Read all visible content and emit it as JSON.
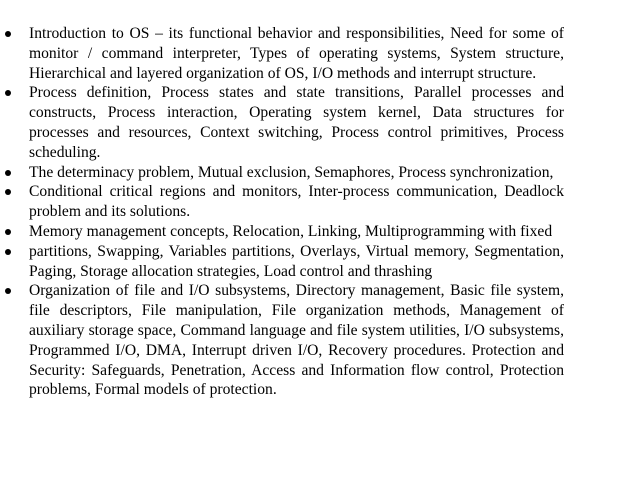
{
  "syllabus": {
    "items": [
      {
        "text": "Introduction to OS – its functional behavior and responsibilities, Need for some of monitor / command interpreter, Types of operating systems, System structure, Hierarchical and layered organization of OS, I/O methods and interrupt structure."
      },
      {
        "text": "Process definition, Process states and state transitions, Parallel processes and constructs, Process interaction, Operating system kernel, Data structures for processes and resources, Context switching, Process control primitives, Process scheduling."
      },
      {
        "text": "The determinacy problem, Mutual exclusion, Semaphores, Process synchronization,"
      },
      {
        "text": "Conditional critical regions and monitors, Inter-process communication, Deadlock problem and its solutions."
      },
      {
        "text": "Memory management concepts, Relocation, Linking, Multiprogramming with fixed"
      },
      {
        "text": "partitions, Swapping, Variables partitions, Overlays, Virtual memory, Segmentation, Paging, Storage allocation strategies, Load control and thrashing"
      },
      {
        "text": "Organization of file and I/O subsystems, Directory management, Basic file system, file descriptors, File manipulation, File organization methods, Management of auxiliary storage space, Command language and file system utilities, I/O subsystems, Programmed I/O, DMA, Interrupt driven I/O, Recovery procedures. Protection and Security: Safeguards, Penetration, Access and Information flow control, Protection problems, Formal models of protection."
      }
    ]
  }
}
